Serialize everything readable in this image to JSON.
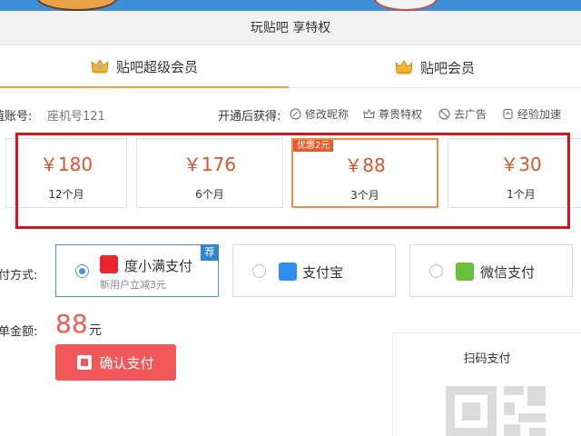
{
  "header": {
    "title": "玩贴吧 享特权"
  },
  "tabs": [
    {
      "label": "贴吧超级会员",
      "icon": "crown-icon",
      "active": true
    },
    {
      "label": "贴吧会员",
      "icon": "crown-icon",
      "active": false
    }
  ],
  "account": {
    "label": "值账号:",
    "value": "座机号121",
    "gain_label": "开通后获得:",
    "perks": [
      {
        "label": "修改昵称",
        "icon": "rename-icon"
      },
      {
        "label": "尊贵特权",
        "icon": "crown-outline-icon"
      },
      {
        "label": "去广告",
        "icon": "no-ads-icon"
      },
      {
        "label": "经验加速",
        "icon": "boost-icon"
      }
    ]
  },
  "plans": [
    {
      "price": "￥180",
      "duration": "12个月",
      "selected": false
    },
    {
      "price": "￥176",
      "duration": "6个月",
      "selected": false
    },
    {
      "price": "￥88",
      "duration": "3个月",
      "selected": true,
      "promo": "优惠2元"
    },
    {
      "price": "￥30",
      "duration": "1个月",
      "selected": false
    }
  ],
  "payment": {
    "label": "付方式:",
    "methods": [
      {
        "name": "度小满支付",
        "sub": "新用户立减3元",
        "badge": "荐",
        "selected": true,
        "icon": "duxiaoman-icon",
        "color": "#e9262b"
      },
      {
        "name": "支付宝",
        "selected": false,
        "icon": "alipay-icon",
        "color": "#2b8ef0"
      },
      {
        "name": "微信支付",
        "selected": false,
        "icon": "wechat-pay-icon",
        "color": "#6bbf3a"
      }
    ]
  },
  "amount": {
    "label": "单金额:",
    "value": "88",
    "unit": "元"
  },
  "confirm_button": {
    "label": "确认支付"
  },
  "qr": {
    "title": "扫码支付"
  },
  "colors": {
    "accent": "#f1a33b",
    "price": "#e2522b",
    "highlight_box": "#d7151a",
    "pay_button": "#f2585a"
  }
}
